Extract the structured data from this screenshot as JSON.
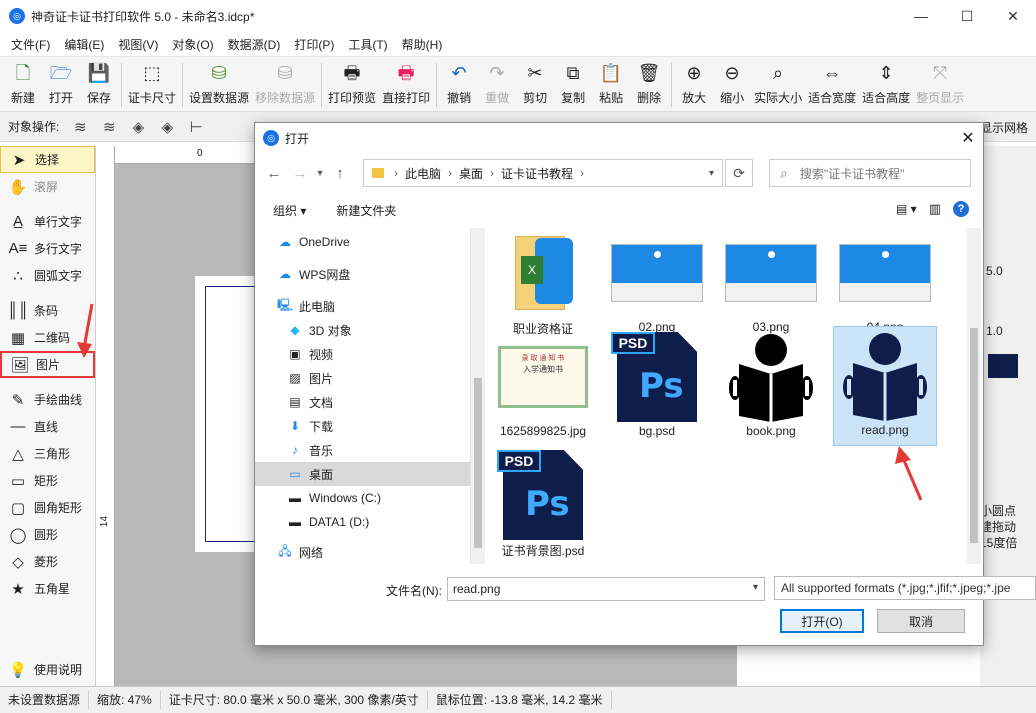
{
  "window": {
    "title": "神奇证卡证书打印软件 5.0 - 未命名3.idcp*",
    "minimize": "—",
    "maximize": "☐",
    "close": "✕"
  },
  "menu": [
    "文件(F)",
    "编辑(E)",
    "视图(V)",
    "对象(O)",
    "数据源(D)",
    "打印(P)",
    "工具(T)",
    "帮助(H)"
  ],
  "toolbar": {
    "new": "新建",
    "open": "打开",
    "save": "保存",
    "card_size": "证卡尺寸",
    "set_datasource": "设置数据源",
    "remove_datasource": "移除数据源",
    "print_preview": "打印预览",
    "direct_print": "直接打印",
    "undo": "撤销",
    "redo": "重做",
    "cut": "剪切",
    "copy": "复制",
    "paste": "粘贴",
    "delete": "删除",
    "zoom_in": "放大",
    "zoom_out": "缩小",
    "actual_size": "实际大小",
    "fit_width": "适合宽度",
    "fit_height": "适合高度",
    "full_page": "整页显示"
  },
  "ops": {
    "label": "对象操作:",
    "grid": "显示网格"
  },
  "left_tools": {
    "select": "选择",
    "pan": "滚屏",
    "single_text": "单行文字",
    "multi_text": "多行文字",
    "arc_text": "圆弧文字",
    "barcode": "条码",
    "qrcode": "二维码",
    "image": "图片",
    "freehand": "手绘曲线",
    "line": "直线",
    "triangle": "三角形",
    "rect": "矩形",
    "round_rect": "圆角矩形",
    "ellipse": "圆形",
    "diamond": "菱形",
    "star": "五角星",
    "help": "使用说明"
  },
  "ruler": {
    "top_zero": "0",
    "left_14": "14"
  },
  "right_panel": {
    "val1": "5.0",
    "val2": "1.0",
    "t1": "小圆点",
    "t2": "建拖动",
    "t3": "15度倍"
  },
  "status": {
    "datasource": "未设置数据源",
    "zoom": "缩放: 47%",
    "card_size": "证卡尺寸: 80.0 毫米 x 50.0 毫米, 300 像素/英寸",
    "mouse": "鼠标位置: -13.8 毫米, 14.2 毫米"
  },
  "dialog": {
    "title": "打开",
    "path": [
      "此电脑",
      "桌面",
      "证卡证书教程"
    ],
    "search_placeholder": "搜索\"证卡证书教程\"",
    "organize": "组织 ▾",
    "new_folder": "新建文件夹",
    "nav": [
      "OneDrive",
      "WPS网盘",
      "此电脑",
      "3D 对象",
      "视频",
      "图片",
      "文档",
      "下载",
      "音乐",
      "桌面",
      "Windows (C:)",
      "DATA1 (D:)",
      "网络"
    ],
    "files": [
      "职业资格证",
      "02.png",
      "03.png",
      "04.png",
      "1625899825.jpg",
      "bg.psd",
      "book.png",
      "read.png",
      "证书背景图.psd"
    ],
    "filename_label": "文件名(N):",
    "filename_value": "read.png",
    "file_type": "All supported formats (*.jpg;*.jfif;*.jpeg;*.jpe",
    "open_button": "打开(O)",
    "cancel_button": "取消",
    "psd_tag": "PSD",
    "ps_mark": "Ps",
    "cert_header": "录 取 通 知 书",
    "cert_sub": "入学通知书"
  },
  "colors": {
    "accent": "#0078d7",
    "dark_navy": "#0f1d4a",
    "red": "#e53935",
    "selected_bg": "#cce4f7"
  }
}
